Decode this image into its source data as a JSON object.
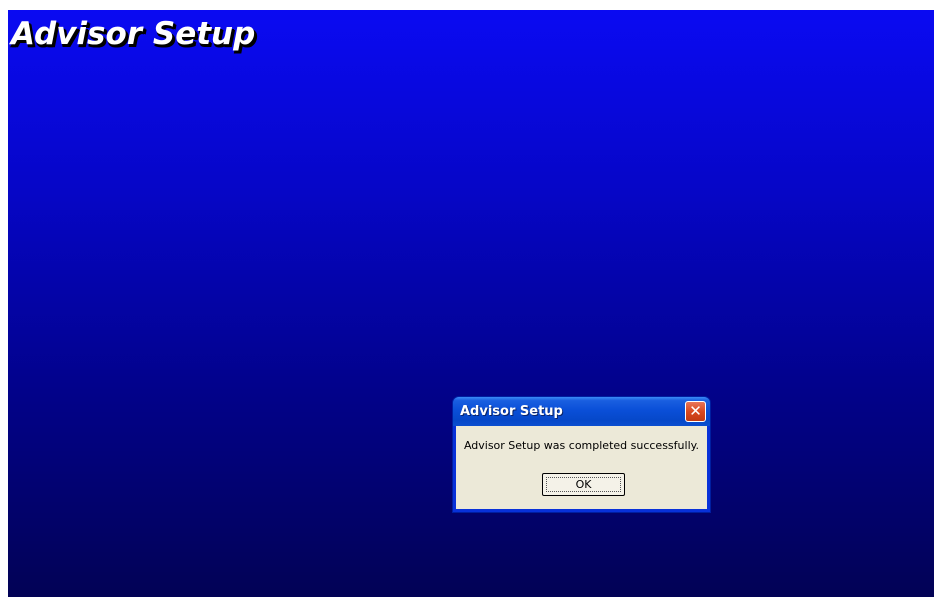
{
  "screen": {
    "title": "Advisor Setup"
  },
  "dialog": {
    "title": "Advisor Setup",
    "close_glyph": "✕",
    "close_icon": "close-icon",
    "message": "Advisor Setup was completed successfully.",
    "ok_label": "OK"
  },
  "colors": {
    "background_top": "#0a0af2",
    "background_bottom": "#020255",
    "titlebar": "#0a4fd8",
    "dialog_face": "#ece9d8",
    "close_button": "#d9491f"
  }
}
